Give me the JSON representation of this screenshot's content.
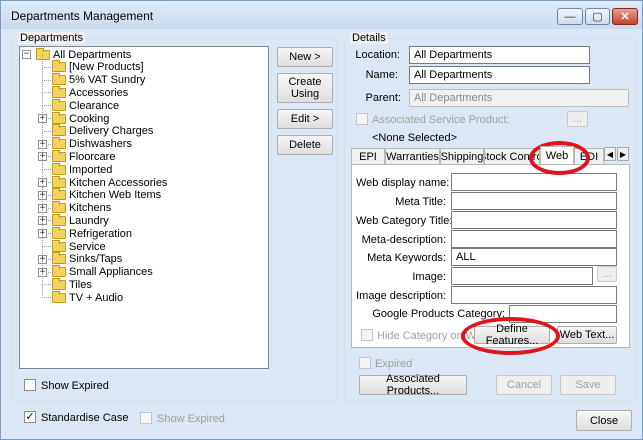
{
  "window": {
    "title": "Departments Management",
    "minimize_glyph": "—",
    "maximize_glyph": "▢",
    "close_glyph": "✕"
  },
  "departments": {
    "group_label": "Departments",
    "tree": [
      {
        "label": "All Departments",
        "level": 0,
        "expander": "−",
        "icon": "folder-icon"
      },
      {
        "label": "[New Products]",
        "level": 1,
        "expander": "",
        "icon": "folder-icon"
      },
      {
        "label": "5% VAT Sundry",
        "level": 1,
        "expander": "",
        "icon": "folder-icon"
      },
      {
        "label": "Accessories",
        "level": 1,
        "expander": "",
        "icon": "folder-icon"
      },
      {
        "label": "Clearance",
        "level": 1,
        "expander": "",
        "icon": "folder-icon"
      },
      {
        "label": "Cooking",
        "level": 1,
        "expander": "+",
        "icon": "folder-icon"
      },
      {
        "label": "Delivery Charges",
        "level": 1,
        "expander": "",
        "icon": "folder-icon"
      },
      {
        "label": "Dishwashers",
        "level": 1,
        "expander": "+",
        "icon": "folder-icon"
      },
      {
        "label": "Floorcare",
        "level": 1,
        "expander": "+",
        "icon": "folder-icon"
      },
      {
        "label": "Imported",
        "level": 1,
        "expander": "",
        "icon": "folder-icon"
      },
      {
        "label": "Kitchen Accessories",
        "level": 1,
        "expander": "+",
        "icon": "folder-icon"
      },
      {
        "label": "Kitchen Web Items",
        "level": 1,
        "expander": "+",
        "icon": "folder-icon"
      },
      {
        "label": "Kitchens",
        "level": 1,
        "expander": "+",
        "icon": "folder-icon"
      },
      {
        "label": "Laundry",
        "level": 1,
        "expander": "+",
        "icon": "folder-icon"
      },
      {
        "label": "Refrigeration",
        "level": 1,
        "expander": "+",
        "icon": "folder-icon"
      },
      {
        "label": "Service",
        "level": 1,
        "expander": "",
        "icon": "folder-icon"
      },
      {
        "label": "Sinks/Taps",
        "level": 1,
        "expander": "+",
        "icon": "folder-icon"
      },
      {
        "label": "Small Appliances",
        "level": 1,
        "expander": "+",
        "icon": "folder-icon"
      },
      {
        "label": "Tiles",
        "level": 1,
        "expander": "",
        "icon": "folder-icon"
      },
      {
        "label": "TV + Audio",
        "level": 1,
        "expander": "",
        "icon": "folder-icon"
      }
    ],
    "show_expired_label": "Show Expired",
    "show_expired_checked": false
  },
  "actions": {
    "new_label": "New >",
    "create_using_label": "Create Using",
    "edit_label": "Edit >",
    "delete_label": "Delete"
  },
  "details": {
    "group_label": "Details",
    "location_label": "Location:",
    "location_value": "All Departments",
    "name_label": "Name:",
    "name_value": "All Departments",
    "parent_label": "Parent:",
    "parent_value": "All Departments",
    "associated_service_label": "Associated Service Product:",
    "associated_service_button": "...",
    "none_selected": "<None Selected>",
    "tabs": [
      "EPI",
      "Warranties",
      "Shipping",
      "Stock Control",
      "Web",
      "EDI"
    ],
    "active_tab": "Web",
    "tab_prev_glyph": "◀",
    "tab_next_glyph": "▶",
    "web": {
      "display_name_label": "Web display name:",
      "display_name_value": "",
      "meta_title_label": "Meta Title:",
      "meta_title_value": "",
      "web_category_title_label": "Web Category Title:",
      "web_category_title_value": "",
      "meta_description_label": "Meta-description:",
      "meta_description_value": "",
      "meta_keywords_label": "Meta Keywords:",
      "meta_keywords_value": "ALL",
      "image_label": "Image:",
      "image_value": "",
      "image_browse_label": "...",
      "image_description_label": "Image description:",
      "image_description_value": "",
      "google_category_label": "Google Products Category:",
      "google_category_value": "",
      "hide_category_label": "Hide Category on Web",
      "define_features_label": "Define Features...",
      "web_text_label": "Web Text..."
    },
    "expired_label": "Expired",
    "associated_products_label": "Associated Products...",
    "cancel_label": "Cancel",
    "save_label": "Save"
  },
  "footer": {
    "standardise_case_label": "Standardise Case",
    "standardise_case_checked": true,
    "show_expired_label": "Show Expired",
    "close_label": "Close"
  },
  "colors": {
    "annotation_ring": "#e0151b",
    "folder": "#f1d35e"
  }
}
